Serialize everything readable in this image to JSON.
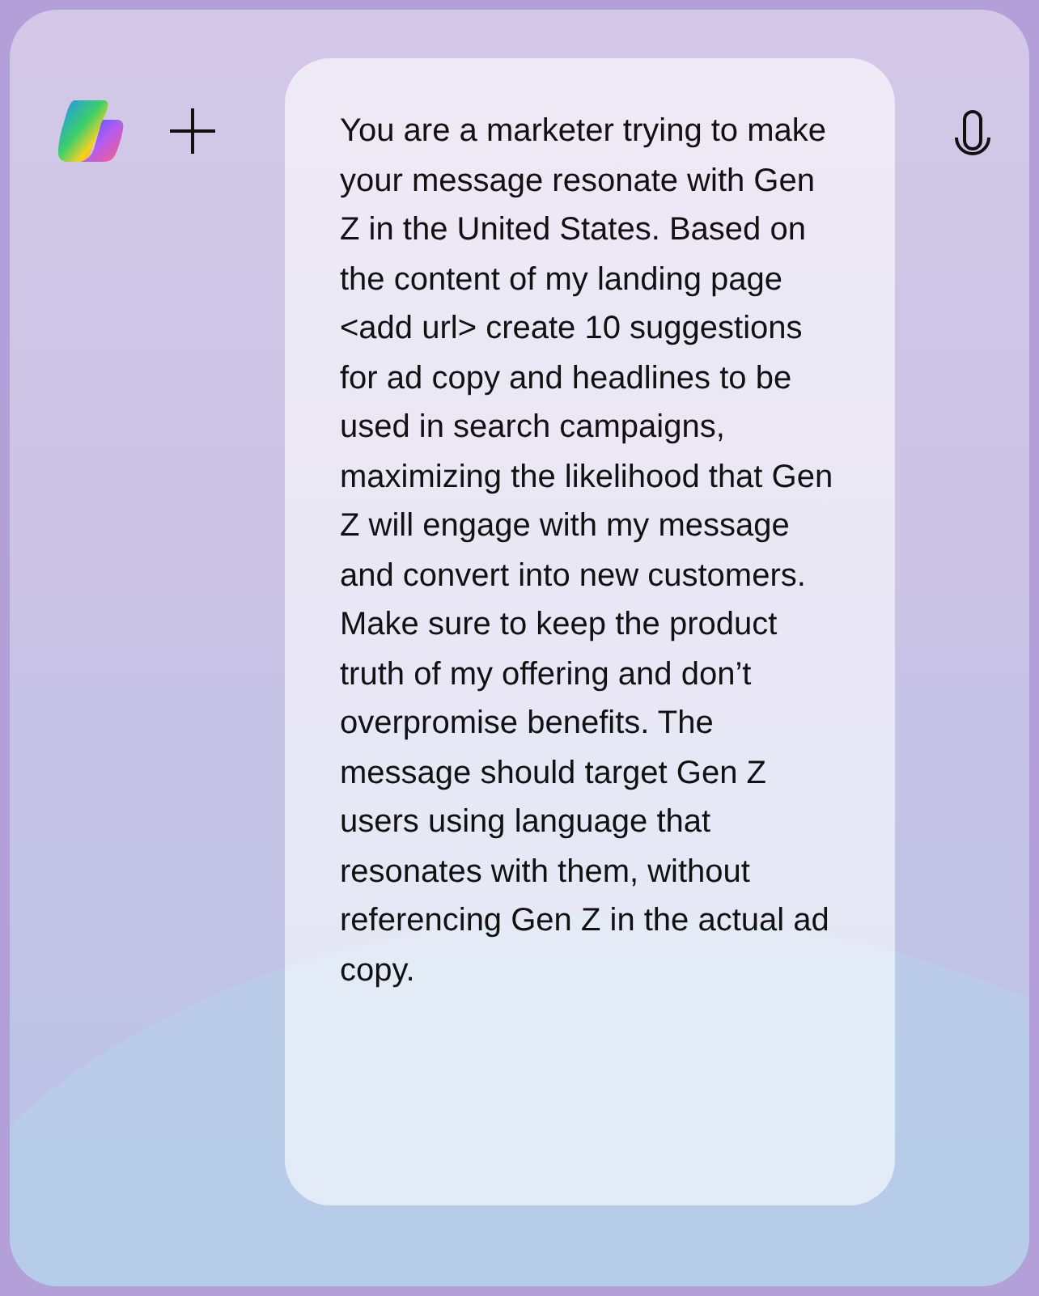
{
  "prompt": {
    "text": "You are a marketer trying to make your message resonate with Gen Z in the United States. Based on the content of my landing page <add url> create 10 suggestions for ad copy and headlines to be used in search campaigns, maximizing the likelihood that Gen Z will engage with my message and convert into new customers. Make sure to keep the product truth of my offering and don’t overpromise benefits. The message should target Gen Z users using language that resonates with them, without referencing Gen Z in the actual ad copy."
  }
}
